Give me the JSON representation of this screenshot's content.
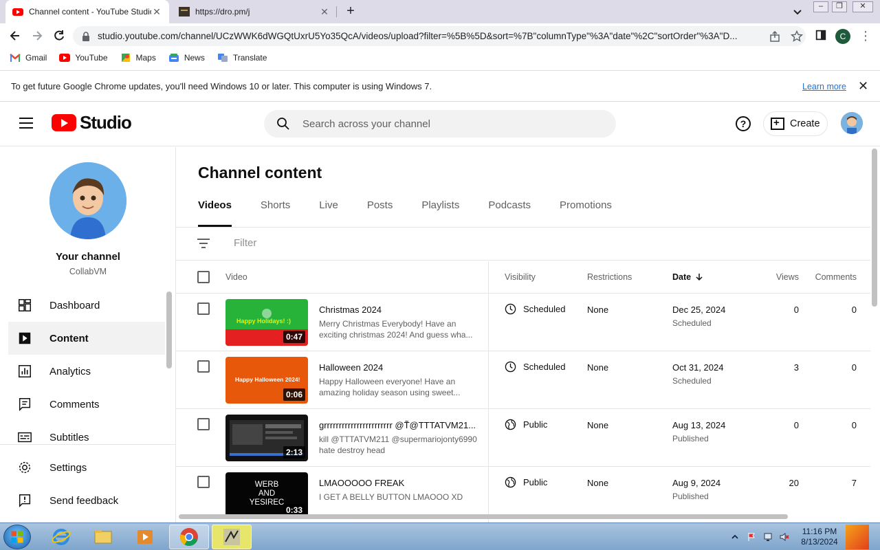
{
  "browser": {
    "tabs": [
      {
        "title": "Channel content - YouTube Studio",
        "active": true
      },
      {
        "title": "https://dro.pm/j",
        "active": false
      }
    ],
    "url": "studio.youtube.com/channel/UCzWWK6dWGQtUxrU5Yo35QcA/videos/upload?filter=%5B%5D&sort=%7B\"columnType\"%3A\"date\"%2C\"sortOrder\"%3A\"D...",
    "profile_initial": "C",
    "bookmarks": [
      "Gmail",
      "YouTube",
      "Maps",
      "News",
      "Translate"
    ],
    "infobar": {
      "message": "To get future Google Chrome updates, you'll need Windows 10 or later. This computer is using Windows 7.",
      "link": "Learn more"
    }
  },
  "studio": {
    "logo_text": "Studio",
    "search_placeholder": "Search across your channel",
    "create_label": "Create",
    "accent": "#ff0000"
  },
  "sidebar": {
    "channel_name": "Your channel",
    "channel_handle": "CollabVM",
    "items": [
      {
        "label": "Dashboard",
        "icon": "dashboard-icon"
      },
      {
        "label": "Content",
        "icon": "content-icon",
        "active": true
      },
      {
        "label": "Analytics",
        "icon": "analytics-icon"
      },
      {
        "label": "Comments",
        "icon": "comments-icon"
      },
      {
        "label": "Subtitles",
        "icon": "subtitles-icon"
      }
    ],
    "bottom_items": [
      {
        "label": "Settings",
        "icon": "gear-icon"
      },
      {
        "label": "Send feedback",
        "icon": "feedback-icon"
      }
    ]
  },
  "content": {
    "title": "Channel content",
    "tabs": [
      "Videos",
      "Shorts",
      "Live",
      "Posts",
      "Playlists",
      "Podcasts",
      "Promotions"
    ],
    "filter_placeholder": "Filter",
    "columns": {
      "video": "Video",
      "visibility": "Visibility",
      "restrictions": "Restrictions",
      "date": "Date",
      "views": "Views",
      "comments": "Comments"
    },
    "rows": [
      {
        "thumb_text": "Happy Holidays! :)",
        "duration": "0:47",
        "title": "Christmas 2024",
        "description": "Merry Christmas Everybody! Have an exciting christmas 2024! And guess wha...",
        "visibility": "Scheduled",
        "restrictions": "None",
        "date": "Dec 25, 2024",
        "date_status": "Scheduled",
        "views": "0",
        "comments": "0"
      },
      {
        "thumb_text": "Happy Halloween 2024!",
        "duration": "0:06",
        "title": "Halloween 2024",
        "description": "Happy Halloween everyone! Have an amazing holiday season using sweet...",
        "visibility": "Scheduled",
        "restrictions": "None",
        "date": "Oct 31, 2024",
        "date_status": "Scheduled",
        "views": "3",
        "comments": "0"
      },
      {
        "thumb_text": "",
        "duration": "2:13",
        "title": "grrrrrrrrrrrrrrrrrrrrrrr @T̃@TTTATVM21...",
        "description": "kill @TTTATVM211 @supermariojonty6990 hate destroy head",
        "visibility": "Public",
        "restrictions": "None",
        "date": "Aug 13, 2024",
        "date_status": "Published",
        "views": "0",
        "comments": "0"
      },
      {
        "thumb_text": "WERB AND YESIREC",
        "duration": "0:33",
        "title": "LMAOOOOO FREAK",
        "description": "I GET A BELLY BUTTON LMAOOO XD",
        "visibility": "Public",
        "restrictions": "None",
        "date": "Aug 9, 2024",
        "date_status": "Published",
        "views": "20",
        "comments": "7"
      }
    ]
  },
  "taskbar": {
    "time": "11:16 PM",
    "date": "8/13/2024"
  }
}
